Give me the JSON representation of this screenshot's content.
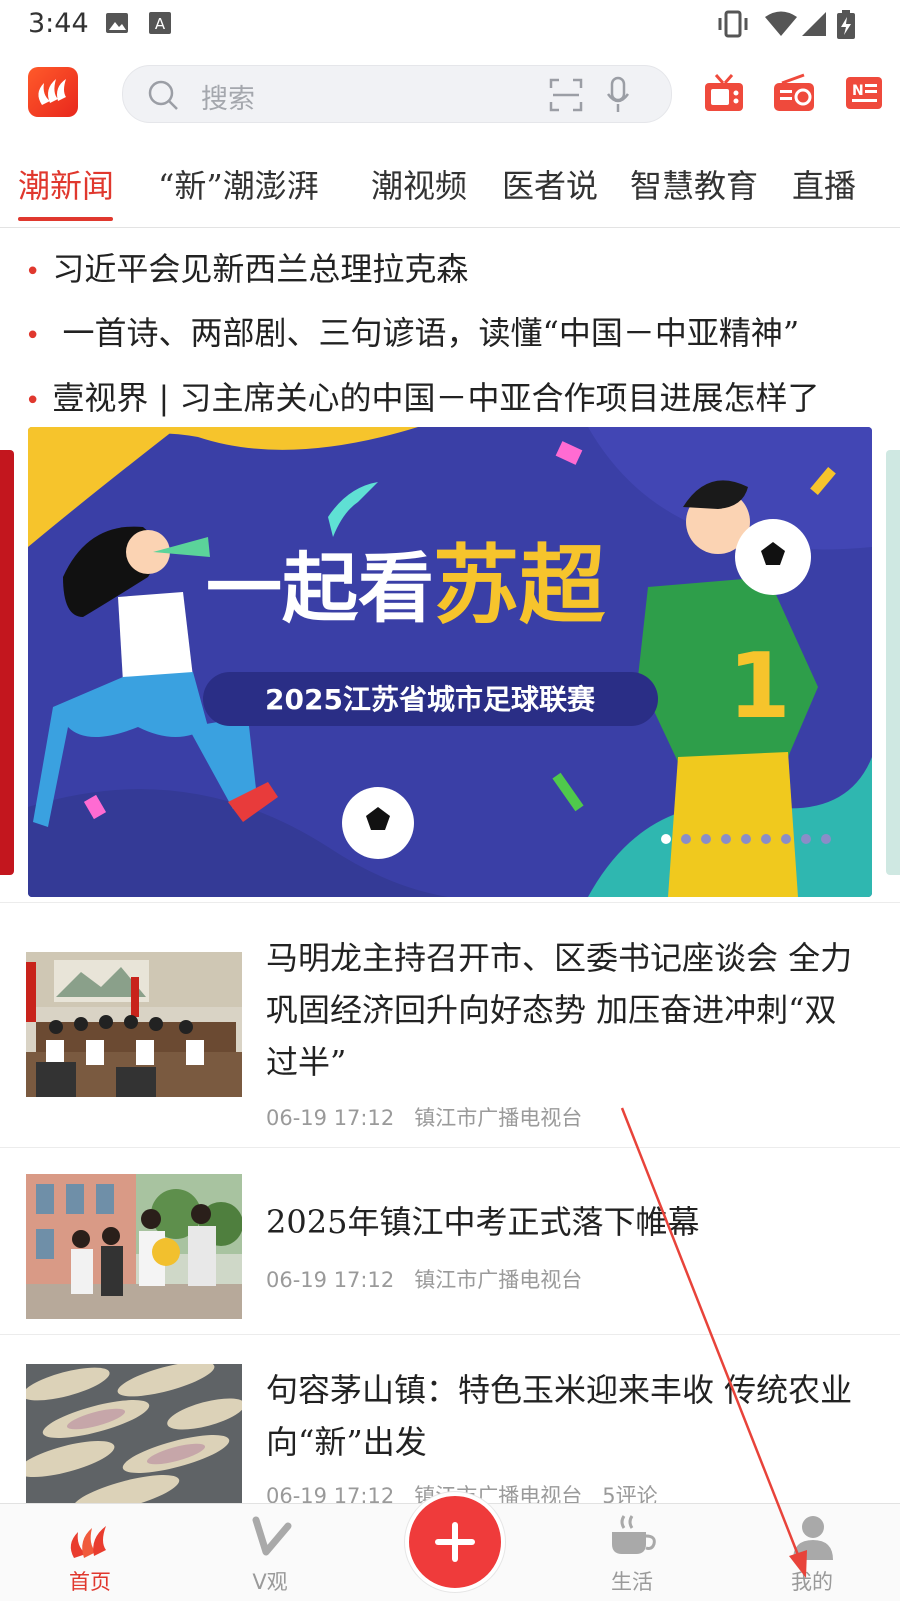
{
  "status_bar": {
    "time": "3:44"
  },
  "header": {
    "logo_icon": "app-logo-icon",
    "search_placeholder": "搜索",
    "icons": [
      "tv-icon",
      "radio-icon",
      "newspaper-icon"
    ]
  },
  "tabs": [
    {
      "label": "潮新闻",
      "active": true
    },
    {
      "label": "“新”潮澎湃"
    },
    {
      "label": "潮视频"
    },
    {
      "label": "医者说"
    },
    {
      "label": "智慧教育"
    },
    {
      "label": "直播"
    }
  ],
  "headlines": [
    "习近平会见新西兰总理拉克森",
    " 一首诗、两部剧、三句谚语，读懂“中国－中亚精神”",
    "壹视界 | 习主席关心的中国－中亚合作项目进展怎样了"
  ],
  "banner": {
    "title_part1": "一起看",
    "title_part2": "苏超",
    "subtitle": "2025江苏省城市足球联赛",
    "slide_count": 9,
    "active_slide": 1
  },
  "news": [
    {
      "title": "马明龙主持召开市、区委书记座谈会 全力巩固经济回升向好态势 加压奋进冲刺“双过半”",
      "time": "06-19 17:12",
      "source": "镇江市广播电视台",
      "comments": ""
    },
    {
      "title": "2025年镇江中考正式落下帷幕",
      "time": "06-19 17:12",
      "source": "镇江市广播电视台",
      "comments": ""
    },
    {
      "title": "句容茅山镇：特色玉米迎来丰收 传统农业向“新”出发",
      "time": "06-19 17:12",
      "source": "镇江市广播电视台",
      "comments": "5评论"
    }
  ],
  "bottom_nav": [
    {
      "label": "首页",
      "icon": "home-logo-icon",
      "active": true
    },
    {
      "label": "V观",
      "icon": "v-icon"
    },
    {
      "label": "",
      "icon": "plus-icon"
    },
    {
      "label": "生活",
      "icon": "coffee-cup-icon"
    },
    {
      "label": "我的",
      "icon": "user-icon"
    }
  ],
  "colors": {
    "accent": "#e0382e",
    "banner_bg": "#3a3fa6",
    "banner_yellow": "#f6c42c"
  }
}
